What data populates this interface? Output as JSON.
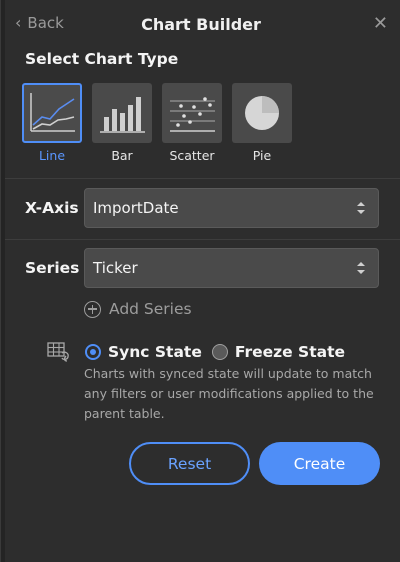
{
  "header": {
    "back_label": "Back",
    "title": "Chart Builder",
    "close_icon": "close-icon"
  },
  "chart_type": {
    "section_title": "Select Chart Type",
    "selected": "Line",
    "types": [
      {
        "label": "Line",
        "icon": "line-chart-icon"
      },
      {
        "label": "Bar",
        "icon": "bar-chart-icon"
      },
      {
        "label": "Scatter",
        "icon": "scatter-chart-icon"
      },
      {
        "label": "Pie",
        "icon": "pie-chart-icon"
      }
    ]
  },
  "x_axis": {
    "label": "X-Axis",
    "value": "ImportDate"
  },
  "series": {
    "label": "Series",
    "value": "Ticker",
    "add_label": "Add Series"
  },
  "state": {
    "icon": "table-link-icon",
    "options": [
      {
        "label": "Sync State",
        "selected": true
      },
      {
        "label": "Freeze State",
        "selected": false
      }
    ],
    "help_text": "Charts with synced state will update to match any filters or user modifications applied to the parent table."
  },
  "buttons": {
    "reset_label": "Reset",
    "create_label": "Create"
  },
  "colors": {
    "accent": "#4f8ef7",
    "panel_bg": "#2d2d2d",
    "field_bg": "#4a4a4a"
  }
}
